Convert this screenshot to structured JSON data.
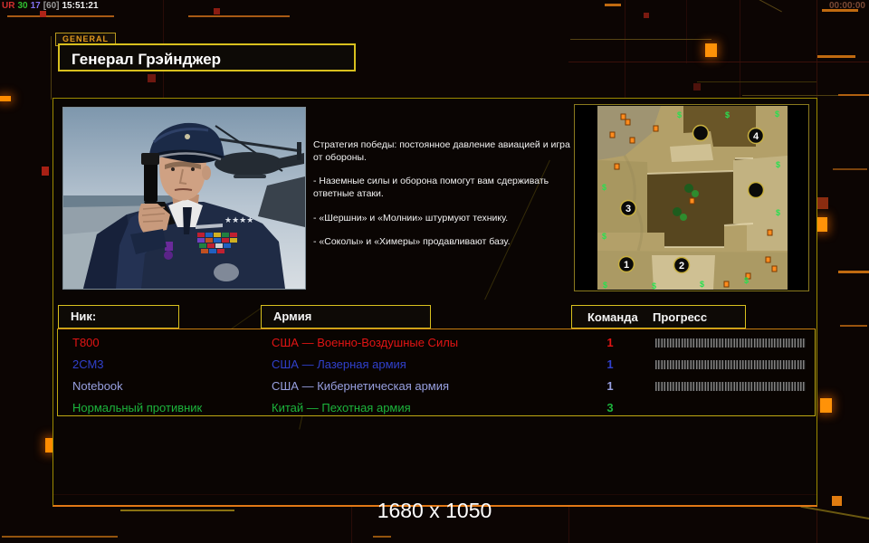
{
  "colors": {
    "accent_yellow": "#d8c01e",
    "accent_orange": "#e07816",
    "panel_border": "#9c8a00",
    "row_red": "#e11414",
    "row_blue": "#3040cc",
    "row_periwinkle": "#98a0e0",
    "row_green": "#1cb53c"
  },
  "top_bar": {
    "fps_counter": {
      "ur": "UR",
      "v1": "30",
      "v2": "17",
      "v3": "[60]",
      "time": "15:51:21"
    },
    "session_timer": "00:00:00"
  },
  "general_tab": {
    "label": "GENERAL"
  },
  "header": {
    "title": "Генерал Грэйнджер"
  },
  "strategy": {
    "paragraphs": [
      "Стратегия победы: постоянное давление авиацией и игра от обороны.",
      "- Наземные силы и оборона помогут вам сдерживать ответные атаки.",
      "- «Шершни» и «Молнии» штурмуют технику.",
      "- «Соколы» и «Химеры» продавливают базу."
    ]
  },
  "minimap": {
    "supply_symbol": "$",
    "start_positions": [
      "1",
      "2",
      "3",
      "4"
    ]
  },
  "table": {
    "headers": {
      "nick": "Ник:",
      "army": "Армия",
      "team": "Команда",
      "progress": "Прогресс"
    },
    "rows": [
      {
        "nick": "T800",
        "army": "США — Военно-Воздушные Силы",
        "team": "1",
        "color": "#e11414",
        "has_progress": true
      },
      {
        "nick": "2СМ3",
        "army": "США — Лазерная армия",
        "team": "1",
        "color": "#3040cc",
        "has_progress": true
      },
      {
        "nick": "Notebook",
        "army": "США — Кибернетическая армия",
        "team": "1",
        "color": "#98a0e0",
        "has_progress": true
      },
      {
        "nick": "Нормальный противник",
        "army": "Китай — Пехотная армия",
        "team": "3",
        "color": "#1cb53c",
        "has_progress": false
      }
    ]
  },
  "footer": {
    "resolution": "1680 x 1050"
  }
}
